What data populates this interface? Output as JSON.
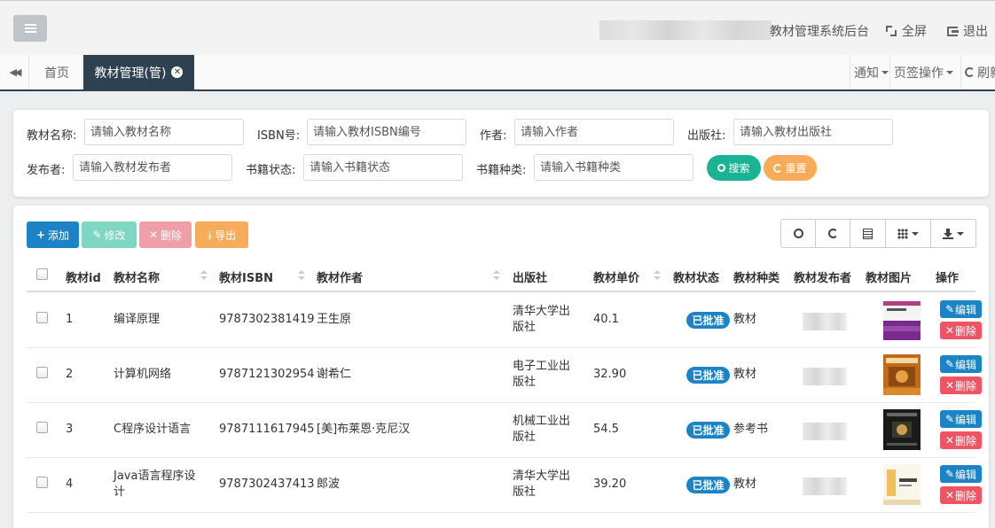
{
  "header": {
    "system_title": "教材管理系统后台",
    "fullscreen_label": "全屏",
    "logout_label": "退出"
  },
  "tabs": {
    "home": "首页",
    "active": "教材管理(管)",
    "notify": "通知",
    "tab_ops": "页签操作",
    "refresh": "刷新"
  },
  "search": {
    "name_label": "教材名称:",
    "name_placeholder": "请输入教材名称",
    "isbn_label": "ISBN号:",
    "isbn_placeholder": "请输入教材ISBN编号",
    "author_label": "作者:",
    "author_placeholder": "请输入作者",
    "press_label": "出版社:",
    "press_placeholder": "请输入教材出版社",
    "publisher_label": "发布者:",
    "publisher_placeholder": "请输入教材发布者",
    "status_label": "书籍状态:",
    "status_placeholder": "请输入书籍状态",
    "type_label": "书籍种类:",
    "type_placeholder": "请输入书籍种类",
    "search_btn": "搜索",
    "reset_btn": "重置"
  },
  "toolbar": {
    "add": "添加",
    "edit": "修改",
    "delete": "删除",
    "export": "导出"
  },
  "table": {
    "headers": [
      "教材id",
      "教材名称",
      "教材ISBN",
      "教材作者",
      "出版社",
      "教材单价",
      "教材状态",
      "教材种类",
      "教材发布者",
      "教材图片",
      "操作"
    ],
    "edit_label": "编辑",
    "delete_label": "删除",
    "rows": [
      {
        "id": "1",
        "name": "编译原理",
        "isbn": "9787302381419",
        "author": "王生原",
        "press": "清华大学出版社",
        "price": "40.1",
        "status": "已批准",
        "type": "教材"
      },
      {
        "id": "2",
        "name": "计算机网络",
        "isbn": "9787121302954",
        "author": "谢希仁",
        "press": "电子工业出版社",
        "price": "32.90",
        "status": "已批准",
        "type": "教材"
      },
      {
        "id": "3",
        "name": "C程序设计语言",
        "isbn": "9787111617945",
        "author": "[美]布莱恩·克尼汉",
        "press": "机械工业出版社",
        "price": "54.5",
        "status": "已批准",
        "type": "参考书"
      },
      {
        "id": "4",
        "name": "Java语言程序设计",
        "isbn": "9787302437413",
        "author": "郎波",
        "press": "清华大学出版社",
        "price": "39.20",
        "status": "已批准",
        "type": "教材"
      }
    ]
  }
}
